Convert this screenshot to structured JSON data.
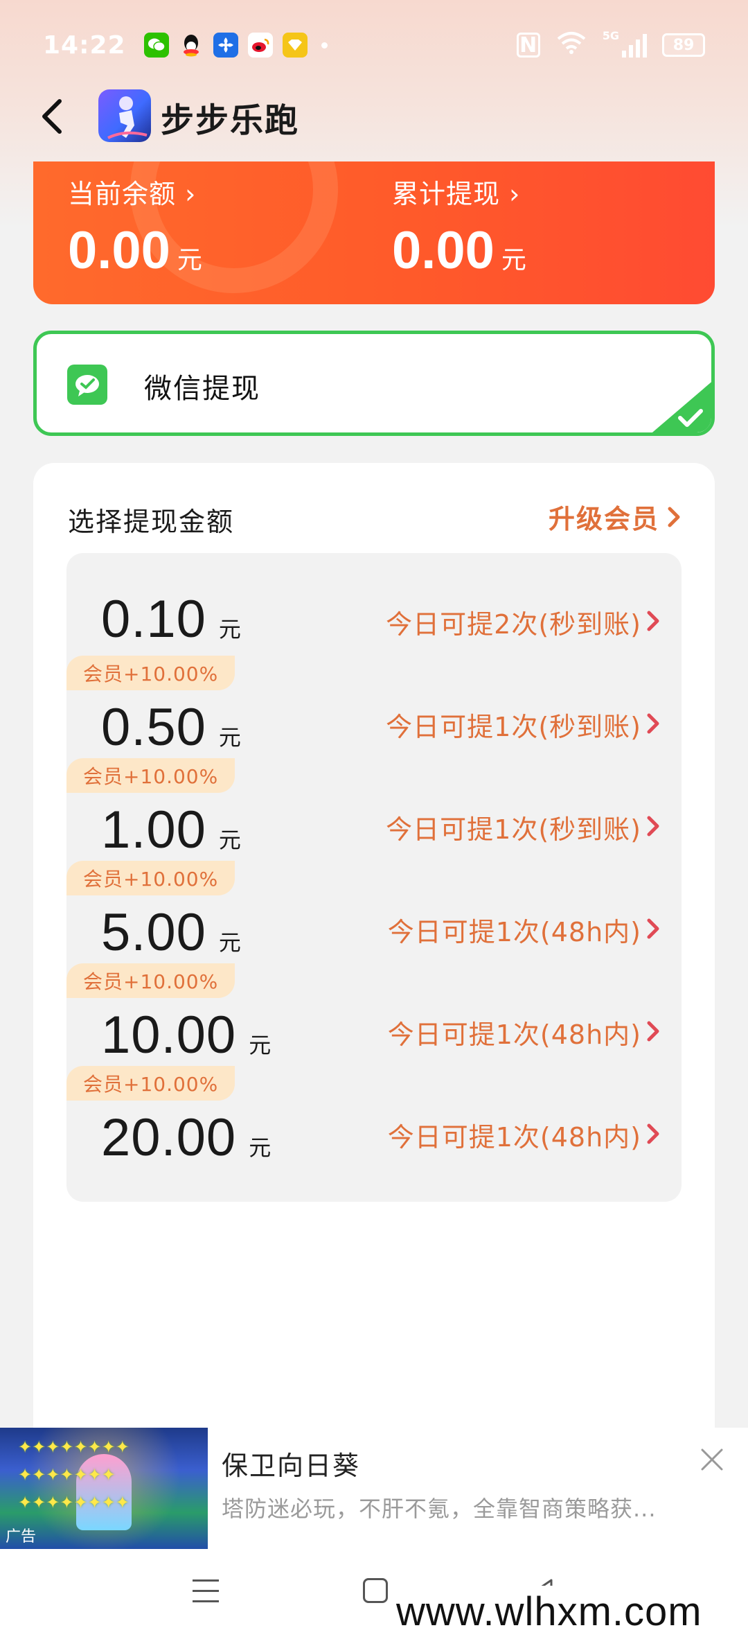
{
  "status_bar": {
    "time": "14:22",
    "network": "5G",
    "battery": "89"
  },
  "header": {
    "title": "步步乐跑"
  },
  "balance": {
    "current_label": "当前余额 ›",
    "current_value": "0.00",
    "current_unit": "元",
    "total_label": "累计提现 ›",
    "total_value": "0.00",
    "total_unit": "元"
  },
  "withdraw_method": {
    "label": "微信提现",
    "selected": true
  },
  "amounts": {
    "title": "选择提现金额",
    "upgrade_label": "升级会员",
    "options": [
      {
        "badge": "",
        "value": "0.10",
        "unit": "元",
        "info": "今日可提2次(秒到账)"
      },
      {
        "badge": "会员+10.00%",
        "value": "0.50",
        "unit": "元",
        "info": "今日可提1次(秒到账)"
      },
      {
        "badge": "会员+10.00%",
        "value": "1.00",
        "unit": "元",
        "info": "今日可提1次(秒到账)"
      },
      {
        "badge": "会员+10.00%",
        "value": "5.00",
        "unit": "元",
        "info": "今日可提1次(48h内)"
      },
      {
        "badge": "会员+10.00%",
        "value": "10.00",
        "unit": "元",
        "info": "今日可提1次(48h内)"
      },
      {
        "badge": "会员+10.00%",
        "value": "20.00",
        "unit": "元",
        "info": "今日可提1次(48h内)"
      }
    ]
  },
  "ad": {
    "title": "保卫向日葵",
    "description": "塔防迷必玩，不肝不氪，全靠智商策略获...",
    "tag": "广告"
  },
  "watermark": "www.wlhxm.com",
  "colors": {
    "accent_orange": "#e0703a",
    "balance_card": "#ff5a2a",
    "wechat_green": "#3ec754",
    "member_badge_bg": "#fde7c8"
  }
}
